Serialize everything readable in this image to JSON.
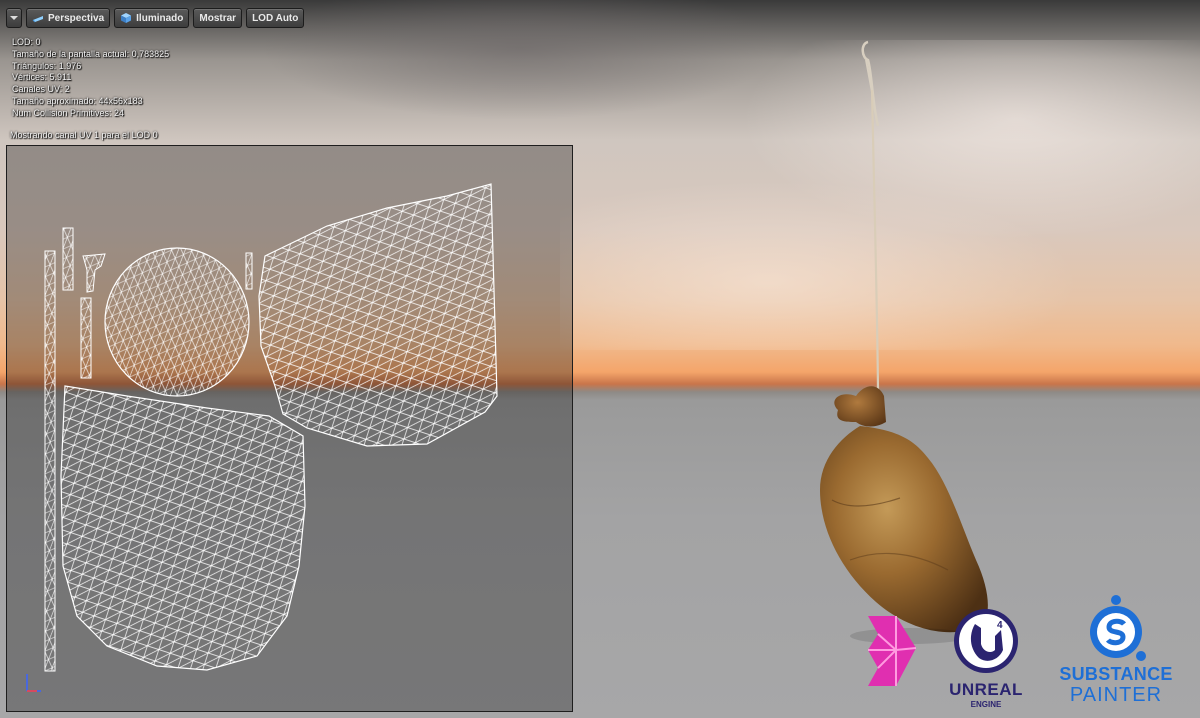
{
  "toolbar": {
    "menu_icon": "dropdown-arrow-icon",
    "perspective_label": "Perspectiva",
    "lit_label": "Iluminado",
    "show_label": "Mostrar",
    "lod_label": "LOD Auto"
  },
  "stats": {
    "lod": "LOD:  0",
    "screen_size": "Tamaño de la pantalla actual: 0,783825",
    "triangles": "Triángulos: 1.976",
    "vertices": "Vértices: 5.911",
    "uv_channels": "Canales UV: 2",
    "approx_size": "Tamaño aproximado: 44x56x183",
    "collision": "Num Collision Primitives:  24"
  },
  "uv_caption": "Mostrando canal UV 1 para el LOD 0",
  "logos": {
    "ue_word": "UNREAL",
    "ue_sub": "ENGINE",
    "sp_word1": "SUBSTANCE",
    "sp_word2": "PAINTER"
  },
  "colors": {
    "ue": "#2b2470",
    "sp": "#1e6fd6",
    "magenta": "#e02fb0",
    "sack": "#8a5a28"
  }
}
